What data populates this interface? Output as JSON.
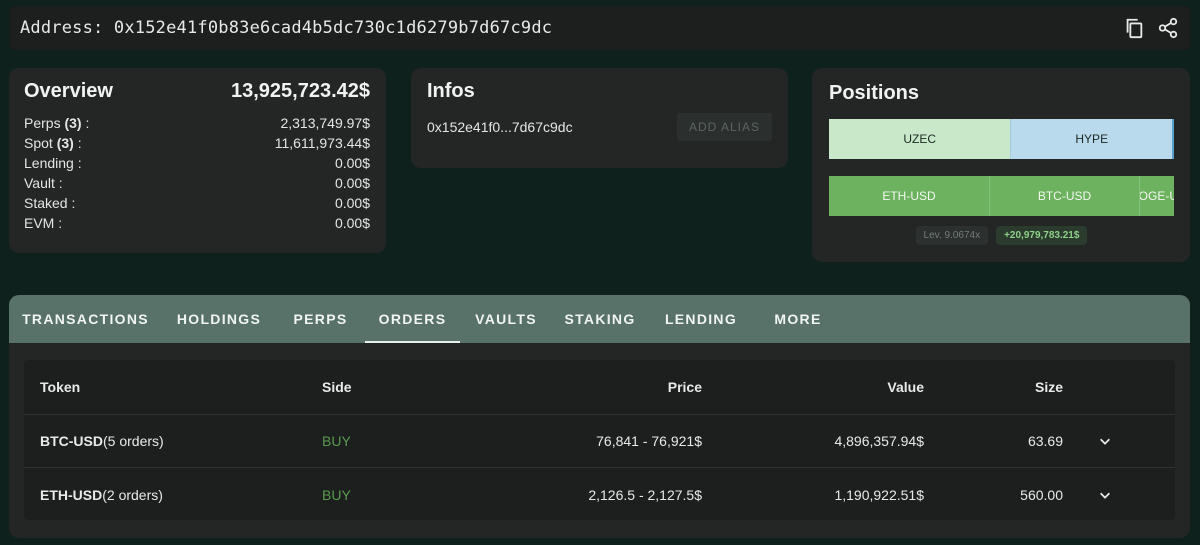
{
  "address_bar": {
    "label": "Address:",
    "address": "0x152e41f0b83e6cad4b5dc730c1d6279b7d67c9dc",
    "copy_icon": "copy-icon",
    "share_icon": "share-icon"
  },
  "overview": {
    "title": "Overview",
    "total": "13,925,723.42$",
    "rows": [
      {
        "label": "Perps",
        "count": "(3)",
        "suffix": " :",
        "value": "2,313,749.97$"
      },
      {
        "label": "Spot",
        "count": "(3)",
        "suffix": " :",
        "value": "11,611,973.44$"
      },
      {
        "label": "Lending :",
        "value": "0.00$"
      },
      {
        "label": "Vault :",
        "value": "0.00$"
      },
      {
        "label": "Staked :",
        "value": "0.00$"
      },
      {
        "label": "EVM :",
        "value": "0.00$"
      }
    ]
  },
  "infos": {
    "title": "Infos",
    "short_address": "0x152e41f0...7d67c9dc",
    "alias_button": "ADD ALIAS"
  },
  "positions": {
    "title": "Positions",
    "spot": [
      "UZEC",
      "HYPE"
    ],
    "perps": [
      "ETH-USD",
      "BTC-USD",
      "DOGE-USD"
    ],
    "leverage": "Lev. 9.0674x",
    "pnl": "+20,979,783.21$"
  },
  "tabs": [
    {
      "label": "TRANSACTIONS"
    },
    {
      "label": "HOLDINGS"
    },
    {
      "label": "PERPS"
    },
    {
      "label": "ORDERS"
    },
    {
      "label": "VAULTS"
    },
    {
      "label": "STAKING"
    },
    {
      "label": "LENDING"
    },
    {
      "label": "MORE"
    }
  ],
  "active_tab": "ORDERS",
  "orders_table": {
    "headers": {
      "token": "Token",
      "side": "Side",
      "price": "Price",
      "value": "Value",
      "size": "Size"
    },
    "rows": [
      {
        "token": "BTC-USD",
        "orders": "(5 orders)",
        "side": "BUY",
        "price": "76,841 - 76,921$",
        "value": "4,896,357.94$",
        "size": "63.69"
      },
      {
        "token": "ETH-USD",
        "orders": "(2 orders)",
        "side": "BUY",
        "price": "2,126.5 - 2,127.5$",
        "value": "1,190,922.51$",
        "size": "560.00"
      }
    ]
  },
  "colors": {
    "background": "#0f211d",
    "card": "#232625",
    "tabs_bar": "#587269",
    "buy": "#5a9a4e",
    "pnl": "#8fd18a"
  }
}
